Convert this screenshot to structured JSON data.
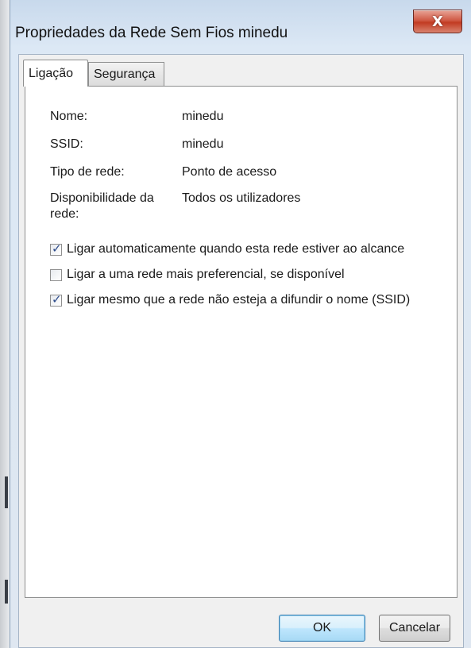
{
  "window": {
    "title": "Propriedades da Rede Sem Fios minedu",
    "close_glyph": "X"
  },
  "tabs": [
    {
      "label": "Ligação",
      "active": true
    },
    {
      "label": "Segurança",
      "active": false
    }
  ],
  "properties": [
    {
      "label": "Nome:",
      "value": "minedu"
    },
    {
      "label": "SSID:",
      "value": "minedu"
    },
    {
      "label": "Tipo de rede:",
      "value": "Ponto de acesso"
    },
    {
      "label": "Disponibilidade da rede:",
      "value": "Todos os utilizadores"
    }
  ],
  "options": [
    {
      "label": "Ligar automaticamente quando esta rede estiver ao alcance",
      "checked": true
    },
    {
      "label": "Ligar a uma rede mais preferencial, se disponível",
      "checked": false
    },
    {
      "label": "Ligar mesmo que a rede não esteja a difundir o nome (SSID)",
      "checked": true
    }
  ],
  "buttons": {
    "ok_label": "OK",
    "cancel_label": "Cancelar"
  },
  "colors": {
    "close_button": "#c23b22",
    "checkmark": "#2c4a8a",
    "default_button_border": "#3c7fb1"
  }
}
